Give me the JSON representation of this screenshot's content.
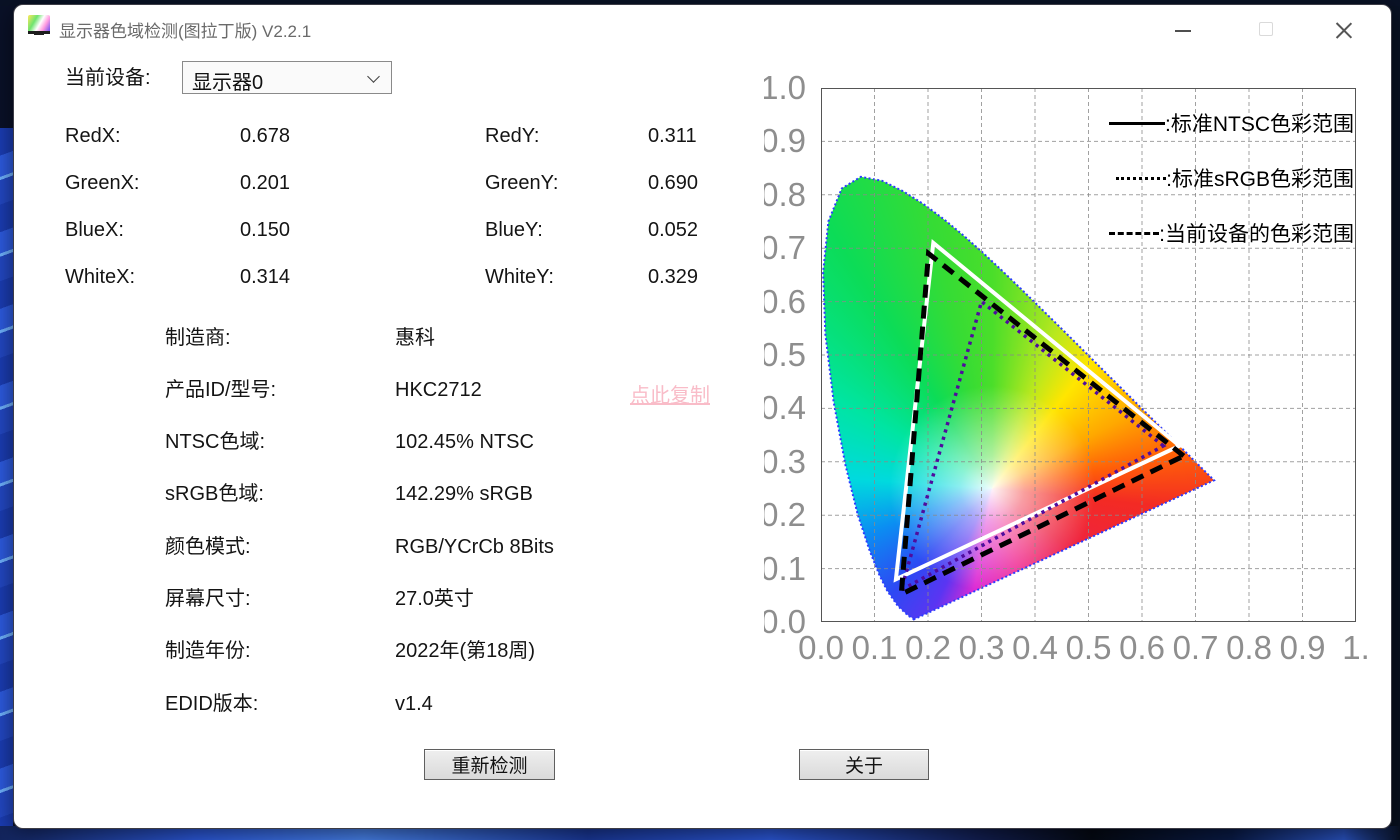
{
  "window": {
    "title": "显示器色域检测(图拉丁版) V2.2.1"
  },
  "form": {
    "device_label": "当前设备:",
    "device_value": "显示器0",
    "coords": [
      {
        "l1": "RedX:",
        "v1": "0.678",
        "l2": "RedY:",
        "v2": "0.311"
      },
      {
        "l1": "GreenX:",
        "v1": "0.201",
        "l2": "GreenY:",
        "v2": "0.690"
      },
      {
        "l1": "BlueX:",
        "v1": "0.150",
        "l2": "BlueY:",
        "v2": "0.052"
      },
      {
        "l1": "WhiteX:",
        "v1": "0.314",
        "l2": "WhiteY:",
        "v2": "0.329"
      }
    ],
    "info": [
      {
        "label": "制造商:",
        "value": "惠科"
      },
      {
        "label": "产品ID/型号:",
        "value": "HKC2712"
      },
      {
        "label": "NTSC色域:",
        "value": "102.45% NTSC"
      },
      {
        "label": "sRGB色域:",
        "value": "142.29% sRGB"
      },
      {
        "label": "颜色模式:",
        "value": "RGB/YCrCb 8Bits"
      },
      {
        "label": "屏幕尺寸:",
        "value": "27.0英寸"
      },
      {
        "label": "制造年份:",
        "value": "2022年(第18周)"
      },
      {
        "label": "EDID版本:",
        "value": "v1.4"
      }
    ],
    "copy_link": "点此复制",
    "redetect_button": "重新检测",
    "about_button": "关于"
  },
  "chart_data": {
    "type": "area",
    "description": "CIE 1931 xy chromaticity diagram with color gamut triangles",
    "xlim": [
      0,
      1
    ],
    "ylim": [
      0,
      1
    ],
    "grid": true,
    "legend_position": "top-right",
    "x_tick_labels": [
      "0.0",
      "0.1",
      "0.2",
      "0.3",
      "0.4",
      "0.5",
      "0.6",
      "0.7",
      "0.8",
      "0.9",
      "1."
    ],
    "y_tick_labels": [
      "1.0",
      "0.9",
      "0.8",
      "0.7",
      "0.6",
      "0.5",
      "0.4",
      "0.3",
      "0.2",
      "0.1",
      "0.0"
    ],
    "legend": [
      ":标准NTSC色彩范围",
      ":标准sRGB色彩范围",
      ":当前设备的色彩范围"
    ],
    "series": [
      {
        "name": "标准NTSC色彩范围",
        "line": "solid",
        "color": "#ffffff",
        "points": [
          [
            0.67,
            0.33
          ],
          [
            0.21,
            0.71
          ],
          [
            0.14,
            0.08
          ]
        ]
      },
      {
        "name": "标准sRGB色彩范围",
        "line": "dotted",
        "color": "#4f0c9e",
        "points": [
          [
            0.64,
            0.33
          ],
          [
            0.3,
            0.6
          ],
          [
            0.15,
            0.06
          ]
        ]
      },
      {
        "name": "当前设备的色彩范围",
        "line": "dashed",
        "color": "#000000",
        "points": [
          [
            0.678,
            0.311
          ],
          [
            0.201,
            0.69
          ],
          [
            0.15,
            0.052
          ]
        ]
      }
    ],
    "spectral_locus": [
      [
        0.1741,
        0.005
      ],
      [
        0.1733,
        0.0048
      ],
      [
        0.1726,
        0.006
      ],
      [
        0.169,
        0.0086
      ],
      [
        0.1644,
        0.0109
      ],
      [
        0.1566,
        0.0177
      ],
      [
        0.144,
        0.0297
      ],
      [
        0.1241,
        0.0578
      ],
      [
        0.1096,
        0.0868
      ],
      [
        0.0913,
        0.1327
      ],
      [
        0.0687,
        0.2007
      ],
      [
        0.0454,
        0.295
      ],
      [
        0.0235,
        0.4127
      ],
      [
        0.0082,
        0.5384
      ],
      [
        0.0039,
        0.6548
      ],
      [
        0.0139,
        0.7502
      ],
      [
        0.0389,
        0.812
      ],
      [
        0.0743,
        0.8338
      ],
      [
        0.1142,
        0.8262
      ],
      [
        0.1547,
        0.8059
      ],
      [
        0.1929,
        0.7816
      ],
      [
        0.2296,
        0.7543
      ],
      [
        0.2658,
        0.7243
      ],
      [
        0.3016,
        0.6923
      ],
      [
        0.3373,
        0.6589
      ],
      [
        0.3731,
        0.6245
      ],
      [
        0.4087,
        0.5896
      ],
      [
        0.4441,
        0.5547
      ],
      [
        0.4788,
        0.5202
      ],
      [
        0.5125,
        0.4866
      ],
      [
        0.5448,
        0.4544
      ],
      [
        0.5752,
        0.4242
      ],
      [
        0.6029,
        0.3965
      ],
      [
        0.627,
        0.3725
      ],
      [
        0.6482,
        0.3514
      ],
      [
        0.6658,
        0.334
      ],
      [
        0.6801,
        0.3197
      ],
      [
        0.6915,
        0.3083
      ],
      [
        0.7079,
        0.292
      ],
      [
        0.719,
        0.2809
      ],
      [
        0.726,
        0.274
      ],
      [
        0.7334,
        0.2666
      ],
      [
        0.7347,
        0.2653
      ]
    ]
  }
}
